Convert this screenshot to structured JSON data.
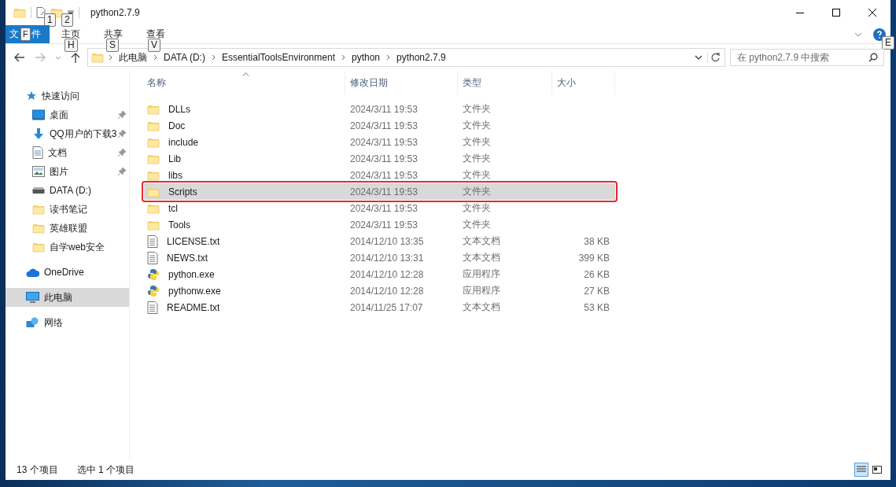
{
  "window": {
    "title": "python2.7.9"
  },
  "quick_access_tips": [
    {
      "key": "1"
    },
    {
      "key": "2"
    }
  ],
  "ribbon_tabs": [
    {
      "label": "文件",
      "key_tip": "F",
      "kind": "file"
    },
    {
      "label": "主页",
      "key_tip": "H",
      "kind": "tab"
    },
    {
      "label": "共享",
      "key_tip": "S",
      "kind": "tab"
    },
    {
      "label": "查看",
      "key_tip": "V",
      "kind": "tab"
    }
  ],
  "help_key_tip": "E",
  "breadcrumb": [
    "此电脑",
    "DATA (D:)",
    "EssentialToolsEnvironment",
    "python",
    "python2.7.9"
  ],
  "search": {
    "placeholder": "在 python2.7.9 中搜索"
  },
  "sidebar": {
    "items": [
      {
        "label": "快速访问",
        "kind": "star",
        "pinned": false,
        "selected": false,
        "children": [
          {
            "label": "桌面",
            "kind": "desktop",
            "pinned": true,
            "selected": false
          },
          {
            "label": "QQ用户的下载3",
            "kind": "download",
            "pinned": true,
            "selected": false
          },
          {
            "label": "文档",
            "kind": "document",
            "pinned": true,
            "selected": false
          },
          {
            "label": "图片",
            "kind": "picture",
            "pinned": true,
            "selected": false
          },
          {
            "label": "DATA (D:)",
            "kind": "drive",
            "pinned": false,
            "selected": false
          },
          {
            "label": "读书笔记",
            "kind": "folder",
            "pinned": false,
            "selected": false
          },
          {
            "label": "英雄联盟",
            "kind": "folder",
            "pinned": false,
            "selected": false
          },
          {
            "label": "自学web安全",
            "kind": "folder",
            "pinned": false,
            "selected": false
          }
        ]
      },
      {
        "label": "OneDrive",
        "kind": "cloud",
        "pinned": false,
        "selected": false
      },
      {
        "label": "此电脑",
        "kind": "computer",
        "pinned": false,
        "selected": true
      },
      {
        "label": "网络",
        "kind": "network",
        "pinned": false,
        "selected": false
      }
    ]
  },
  "table": {
    "columns": [
      "名称",
      "修改日期",
      "类型",
      "大小"
    ],
    "rows": [
      {
        "name": "DLLs",
        "date": "2024/3/11 19:53",
        "type": "文件夹",
        "kind": "folder",
        "selected": false,
        "annotated": false
      },
      {
        "name": "Doc",
        "date": "2024/3/11 19:53",
        "type": "文件夹",
        "kind": "folder",
        "selected": false,
        "annotated": false
      },
      {
        "name": "include",
        "date": "2024/3/11 19:53",
        "type": "文件夹",
        "kind": "folder",
        "selected": false,
        "annotated": false
      },
      {
        "name": "Lib",
        "date": "2024/3/11 19:53",
        "type": "文件夹",
        "kind": "folder",
        "selected": false,
        "annotated": false
      },
      {
        "name": "libs",
        "date": "2024/3/11 19:53",
        "type": "文件夹",
        "kind": "folder",
        "selected": false,
        "annotated": false
      },
      {
        "name": "Scripts",
        "date": "2024/3/11 19:53",
        "type": "文件夹",
        "kind": "folder",
        "selected": true,
        "annotated": true
      },
      {
        "name": "tcl",
        "date": "2024/3/11 19:53",
        "type": "文件夹",
        "kind": "folder",
        "selected": false,
        "annotated": false
      },
      {
        "name": "Tools",
        "date": "2024/3/11 19:53",
        "type": "文件夹",
        "kind": "folder",
        "selected": false,
        "annotated": false
      },
      {
        "name": "LICENSE.txt",
        "date": "2014/12/10 13:35",
        "type": "文本文档",
        "size": "38 KB",
        "kind": "text",
        "selected": false,
        "annotated": false
      },
      {
        "name": "NEWS.txt",
        "date": "2014/12/10 13:31",
        "type": "文本文档",
        "size": "399 KB",
        "kind": "text",
        "selected": false,
        "annotated": false
      },
      {
        "name": "python.exe",
        "date": "2014/12/10 12:28",
        "type": "应用程序",
        "size": "26 KB",
        "kind": "exe",
        "selected": false,
        "annotated": false
      },
      {
        "name": "pythonw.exe",
        "date": "2014/12/10 12:28",
        "type": "应用程序",
        "size": "27 KB",
        "kind": "exe",
        "selected": false,
        "annotated": false
      },
      {
        "name": "README.txt",
        "date": "2014/11/25 17:07",
        "type": "文本文档",
        "size": "53 KB",
        "kind": "text",
        "selected": false,
        "annotated": false
      }
    ]
  },
  "status_bar": {
    "count": "13 个项目",
    "selection": "选中 1 个项目"
  }
}
